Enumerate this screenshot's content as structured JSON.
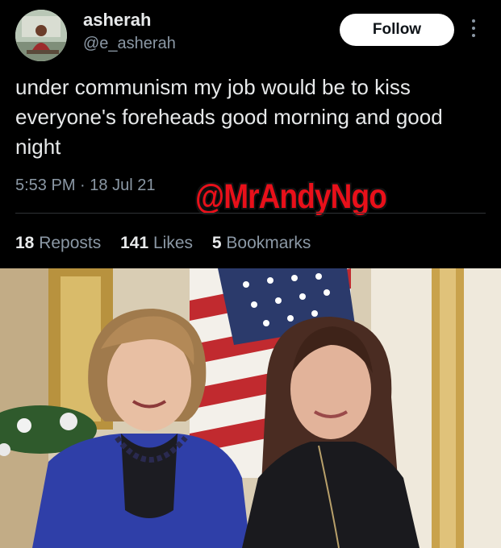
{
  "user": {
    "name": "asherah",
    "handle": "@e_asherah"
  },
  "follow_label": "Follow",
  "tweet": {
    "text": "under communism my job would be to kiss everyone's foreheads good morning and good night",
    "time": "5:53 PM",
    "separator": "·",
    "date": "18 Jul 21"
  },
  "watermark": "@MrAndyNgo",
  "stats": {
    "reposts_count": "18",
    "reposts_label": "Reposts",
    "likes_count": "141",
    "likes_label": "Likes",
    "bookmarks_count": "5",
    "bookmarks_label": "Bookmarks"
  },
  "icons": {
    "more": "more-vertical-icon"
  },
  "colors": {
    "background": "#000000",
    "text_primary": "#e7e9ea",
    "text_secondary": "#8b98a5",
    "watermark": "#e8101a"
  }
}
